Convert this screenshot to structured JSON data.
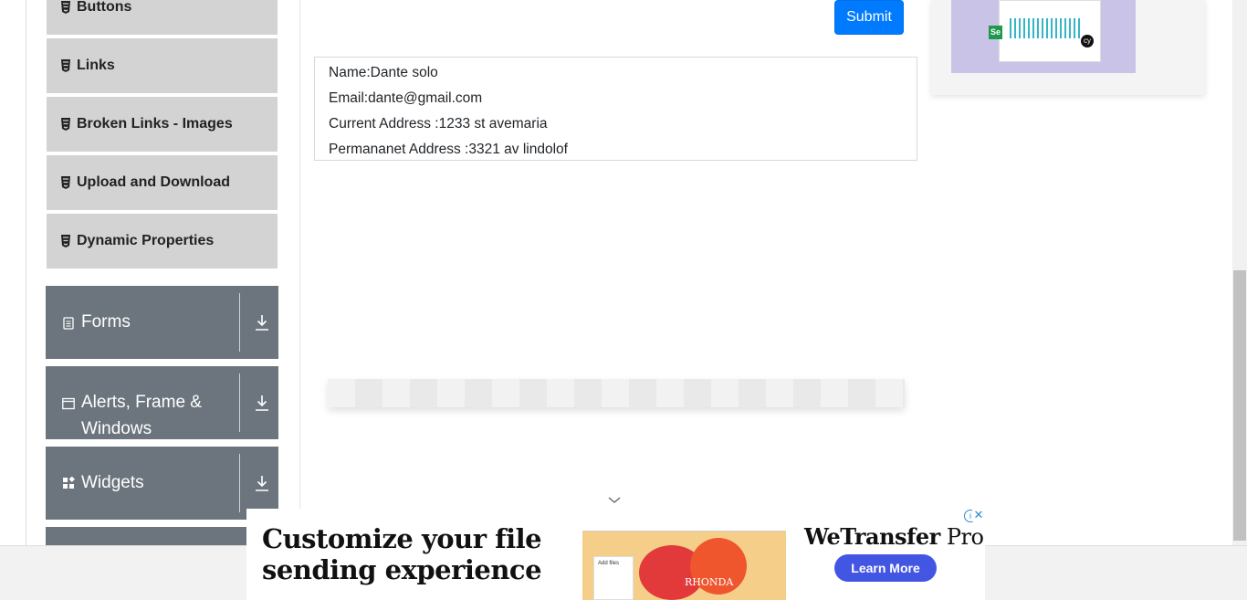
{
  "sidebar": {
    "sub_items": [
      {
        "label": "Buttons"
      },
      {
        "label": "Links"
      },
      {
        "label": "Broken Links - Images"
      },
      {
        "label": "Upload and Download"
      },
      {
        "label": "Dynamic Properties"
      }
    ],
    "groups": [
      {
        "label": "Forms",
        "icon": "form-icon"
      },
      {
        "label": "Alerts, Frame & Windows",
        "icon": "window-icon"
      },
      {
        "label": "Widgets",
        "icon": "widgets-icon"
      }
    ]
  },
  "form": {
    "submit_label": "Submit"
  },
  "output": {
    "name": "Name:Dante solo",
    "email": "Email:dante@gmail.com",
    "current_address": "Current Address :1233 st avemaria",
    "permanent_address": "Permananet Address :3321 av lindolof"
  },
  "ad_banner": {
    "headline_line1": "Customize your file",
    "headline_line2": "sending experience",
    "brand_main": "WeTransfer",
    "brand_suffix": " Pro",
    "cta_label": "Learn More",
    "image_text": "RHONDA",
    "card_text": "Add files",
    "info_glyph": "i",
    "close_glyph": "✕",
    "accent_color": "#4355e3"
  },
  "right_ad": {
    "se_badge": "Se",
    "cy_badge": "cy"
  },
  "colors": {
    "sidebar_group_bg": "#6c757d",
    "sidebar_item_bg": "#d3d3d3",
    "submit_bg": "#007bff"
  }
}
